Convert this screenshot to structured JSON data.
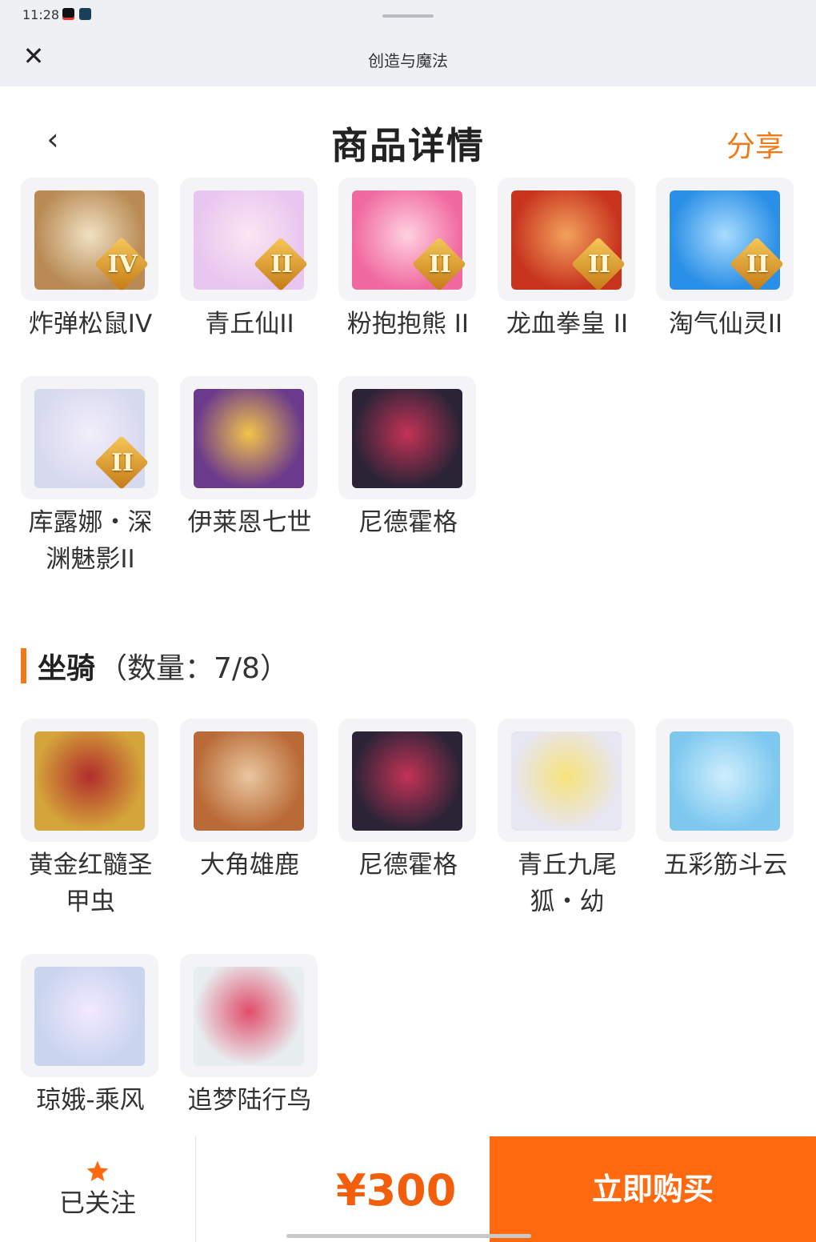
{
  "status_bar": {
    "time": "11:28"
  },
  "mini_bar": {
    "title": "创造与魔法",
    "close_icon": "close-icon"
  },
  "header": {
    "title": "商品详情",
    "share": "分享",
    "back_icon": "chevron-left-icon"
  },
  "pets": {
    "items": [
      {
        "name": "炸弹松鼠IV",
        "badge": "IV",
        "colors": [
          "#b98a54",
          "#efe1c4"
        ]
      },
      {
        "name": "青丘仙II",
        "badge": "II",
        "colors": [
          "#e8c6ef",
          "#fbe6f2"
        ]
      },
      {
        "name": "粉抱抱熊 II",
        "badge": "II",
        "colors": [
          "#f06aa0",
          "#ffd1e0"
        ]
      },
      {
        "name": "龙血拳皇 II",
        "badge": "II",
        "colors": [
          "#c8331e",
          "#f2a25c"
        ]
      },
      {
        "name": "淘气仙灵II",
        "badge": "II",
        "colors": [
          "#2a8fe6",
          "#a9dcff"
        ]
      },
      {
        "name": "库露娜・深渊魅影II",
        "badge": "II",
        "colors": [
          "#d7d9ef",
          "#f2eefa"
        ]
      },
      {
        "name": "伊莱恩七世",
        "badge": "",
        "colors": [
          "#6b3a8c",
          "#f2c44a"
        ]
      },
      {
        "name": "尼德霍格",
        "badge": "",
        "colors": [
          "#2a2436",
          "#c43256"
        ]
      }
    ]
  },
  "mounts": {
    "title": "坐骑",
    "count_text": "（数量：7/8）",
    "items": [
      {
        "name": "黄金红髓圣甲虫",
        "colors": [
          "#d4a53a",
          "#b22c2c"
        ]
      },
      {
        "name": "大角雄鹿",
        "colors": [
          "#b96a36",
          "#e9c7a0"
        ]
      },
      {
        "name": "尼德霍格",
        "colors": [
          "#2a2436",
          "#c43256"
        ]
      },
      {
        "name": "青丘九尾狐・幼",
        "colors": [
          "#e7e6f3",
          "#f6e37a"
        ]
      },
      {
        "name": "五彩筋斗云",
        "colors": [
          "#7ec8ef",
          "#cfeefc"
        ]
      },
      {
        "name": "琼娥-乘风",
        "colors": [
          "#c9d4ee",
          "#f2e9ff"
        ]
      },
      {
        "name": "追梦陆行鸟",
        "colors": [
          "#e8eef0",
          "#e04d6a"
        ]
      }
    ]
  },
  "bottom": {
    "follow_label": "已关注",
    "price": "¥300",
    "buy_label": "立即购买",
    "accent": "#ff6a10"
  }
}
